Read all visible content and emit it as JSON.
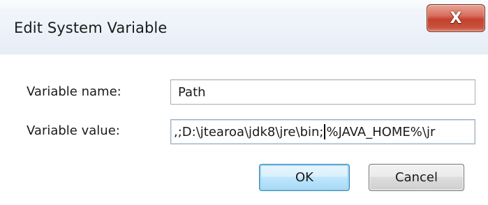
{
  "window": {
    "title": "Edit System Variable",
    "close_glyph": "X",
    "close_icon": "close-icon"
  },
  "form": {
    "name_label": "Variable name:",
    "name_value": "Path",
    "value_label": "Variable value:",
    "value_before_caret": ",;D:\\jtearoa\\jdk8\\jre\\bin;",
    "value_after_caret": "%JAVA_HOME%\\jr"
  },
  "buttons": {
    "ok_label": "OK",
    "cancel_label": "Cancel"
  },
  "colors": {
    "close_button": "#c6412d",
    "ok_border": "#3c7fb1",
    "default_border": "#707070"
  }
}
